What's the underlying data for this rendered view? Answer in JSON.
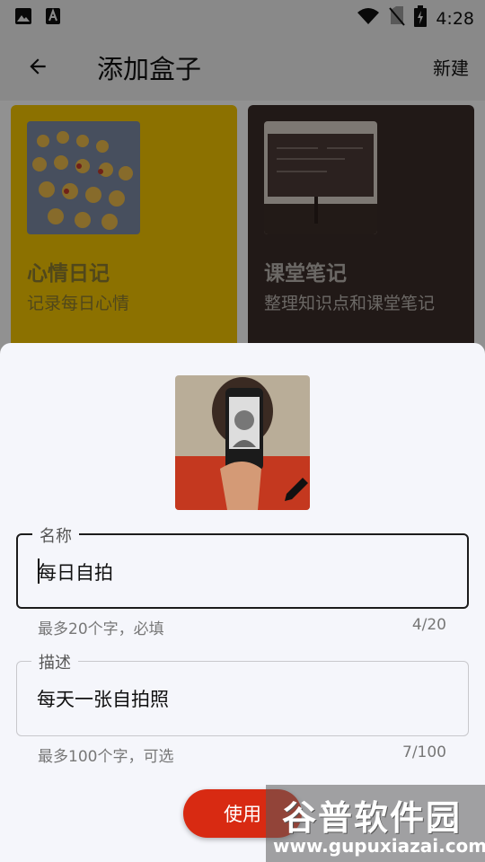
{
  "status_bar": {
    "time": "4:28"
  },
  "app_bar": {
    "title": "添加盒子",
    "new_label": "新建"
  },
  "boxes": [
    {
      "title": "心情日记",
      "subtitle": "记录每日心情",
      "color": "#f2c300"
    },
    {
      "title": "课堂笔记",
      "subtitle": "整理知识点和课堂笔记",
      "color": "#3a2c28"
    }
  ],
  "sheet": {
    "name": {
      "label": "名称",
      "value": "每日自拍",
      "helper": "最多20个字，必填",
      "counter": "4/20"
    },
    "desc": {
      "label": "描述",
      "value": "每天一张自拍照",
      "helper": "最多100个字，可选",
      "counter": "7/100"
    },
    "use_label": "使用"
  },
  "watermark": {
    "text": "谷普软件园",
    "url": "www.gupuxiazai.com"
  },
  "colors": {
    "accent": "#d82a12"
  }
}
